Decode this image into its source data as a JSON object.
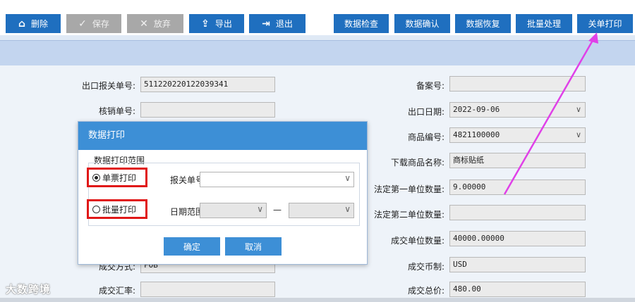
{
  "toolbar": {
    "delete": {
      "label": "删除",
      "icon": "trash-icon"
    },
    "save": {
      "label": "保存",
      "icon": "check-icon"
    },
    "discard": {
      "label": "放弃",
      "icon": "x-icon"
    },
    "export": {
      "label": "导出",
      "icon": "upload-icon"
    },
    "exit": {
      "label": "退出",
      "icon": "exit-icon"
    },
    "right": [
      "数据检查",
      "数据确认",
      "数据恢复",
      "批量处理",
      "关单打印"
    ]
  },
  "form": {
    "export_decl_no": {
      "label": "出口报关单号:",
      "value": "511220220122039341"
    },
    "verify_no": {
      "label": "核销单号:",
      "value": ""
    },
    "record_no": {
      "label": "备案号:",
      "value": ""
    },
    "export_date": {
      "label": "出口日期:",
      "value": "2022-09-06"
    },
    "product_code": {
      "label": "商品编号:",
      "value": "4821100000"
    },
    "download_name": {
      "label": "下载商品名称:",
      "value": "商标贴纸"
    },
    "legal_qty1": {
      "label": "法定第一单位数量:",
      "value": "9.00000"
    },
    "legal_qty2": {
      "label": "法定第二单位数量:",
      "value": ""
    },
    "deal_qty": {
      "label": "成交单位数量:",
      "value": "40000.00000"
    },
    "deal_method": {
      "label": "成交方式:",
      "value": "FOB"
    },
    "deal_currency": {
      "label": "成交币制:",
      "value": "USD"
    },
    "exchange_rate": {
      "label": "成交汇率:",
      "value": ""
    },
    "total_price": {
      "label": "成交总价:",
      "value": "480.00"
    }
  },
  "dialog": {
    "title": "数据打印",
    "group_title": "数据打印范围",
    "single_label": "单票打印",
    "batch_label": "批量打印",
    "decl_no_label": "报关单号:",
    "date_range_label": "日期范围:",
    "dash": "—",
    "ok": "确定",
    "cancel": "取消"
  },
  "watermark": "大数跨境",
  "colors": {
    "accent": "#1f6fbf",
    "highlight": "#e01818",
    "arrow": "#e040e8"
  }
}
